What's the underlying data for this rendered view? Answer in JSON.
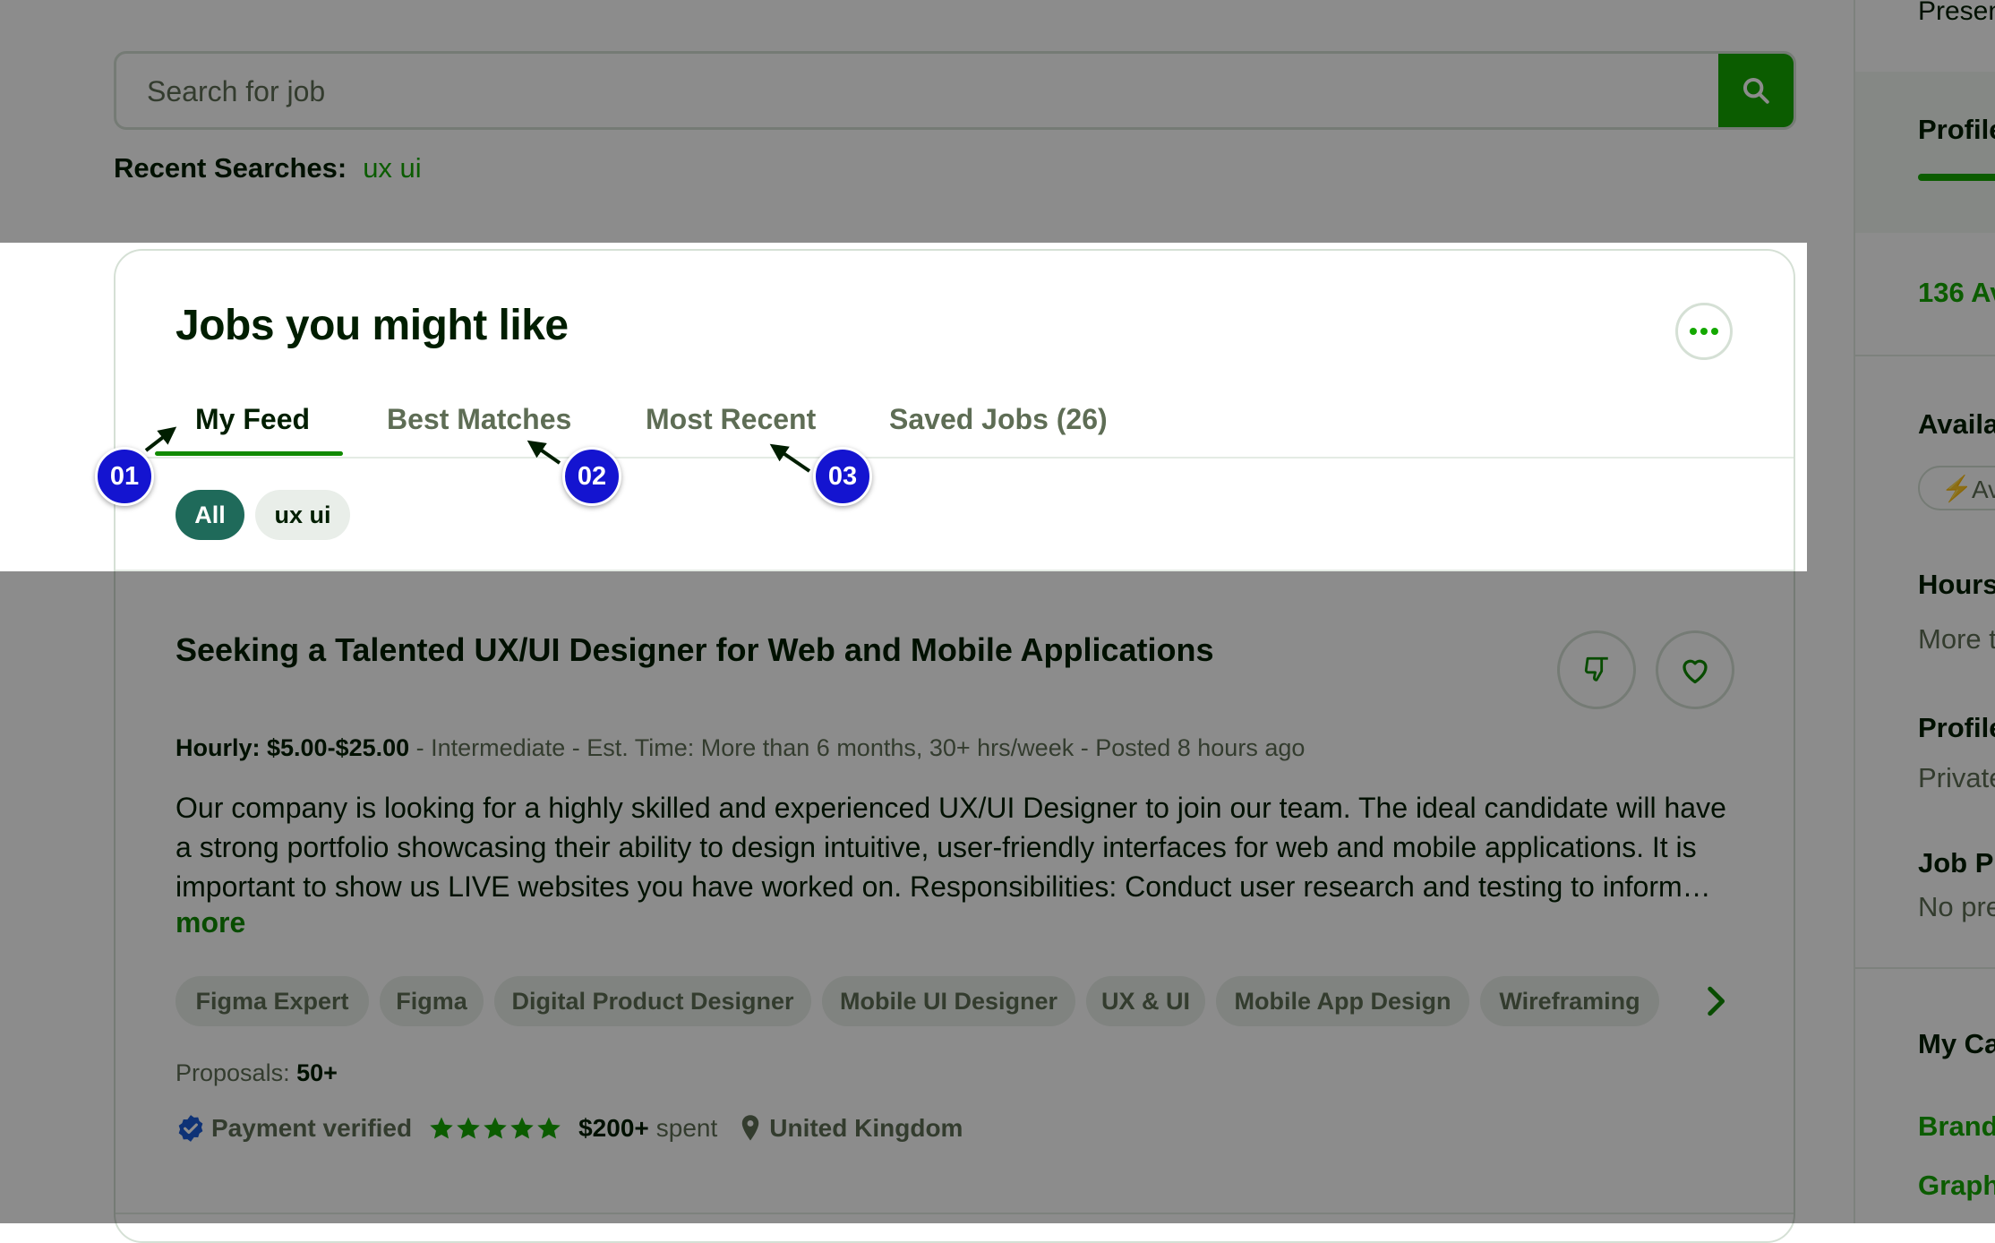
{
  "search": {
    "placeholder": "Search for job",
    "recent_label": "Recent Searches:",
    "recent_items": [
      "ux ui"
    ]
  },
  "sidebar": {
    "items": [
      {
        "text": "Presen",
        "color": "#001e00"
      },
      {
        "text": "Profile",
        "color": "#001e00"
      },
      {
        "text": "136 Av",
        "color": "#14a800"
      },
      {
        "text": "Availa",
        "color": "#001e00"
      },
      {
        "text": "Av",
        "color": "#5e6d55"
      },
      {
        "text": "Hours",
        "color": "#001e00"
      },
      {
        "text": "More t",
        "color": "#5e6d55"
      },
      {
        "text": "Profile",
        "color": "#001e00"
      },
      {
        "text": "Private",
        "color": "#5e6d55"
      },
      {
        "text": "Job Pr",
        "color": "#001e00"
      },
      {
        "text": "No pre",
        "color": "#5e6d55"
      },
      {
        "text": "My Ca",
        "color": "#001e00"
      },
      {
        "text": "Brand",
        "color": "#14a800"
      },
      {
        "text": "Graph",
        "color": "#14a800"
      }
    ]
  },
  "feed": {
    "title": "Jobs you might like",
    "tabs": [
      {
        "label": "My Feed",
        "active": true
      },
      {
        "label": "Best Matches",
        "active": false
      },
      {
        "label": "Most Recent",
        "active": false
      },
      {
        "label": "Saved Jobs (26)",
        "active": false
      }
    ],
    "filters": [
      "All",
      "ux ui"
    ]
  },
  "job": {
    "title": "Seeking a Talented UX/UI Designer for Web and Mobile Applications",
    "rate": "Hourly: $5.00-$25.00",
    "details": " - Intermediate - Est. Time: More than 6 months, 30+ hrs/week - Posted 8 hours ago",
    "description": "Our company is looking for a highly skilled and experienced UX/UI Designer to join our team. The ideal candidate will have a strong portfolio showcasing their ability to design intuitive, user-friendly interfaces for web and mobile applications. It is important to show us LIVE websites you have worked on. Responsibilities: Conduct user research and testing to inform…",
    "more_label": "more",
    "skills": [
      "Figma Expert",
      "Figma",
      "Digital Product Designer",
      "Mobile UI Designer",
      "UX & UI",
      "Mobile App Design",
      "Wireframing"
    ],
    "proposals_label": "Proposals:",
    "proposals_value": "50+",
    "payment_verified": "Payment verified",
    "rating_stars": 5,
    "spent_value": "$200+",
    "spent_label": "spent",
    "location": "United Kingdom"
  },
  "annotations": [
    "01",
    "02",
    "03"
  ],
  "colors": {
    "brand_green": "#14a800",
    "active_chip": "#1f6a5a",
    "badge_blue": "#1414d0",
    "text_dark": "#001e00",
    "text_muted": "#5e6d55"
  }
}
